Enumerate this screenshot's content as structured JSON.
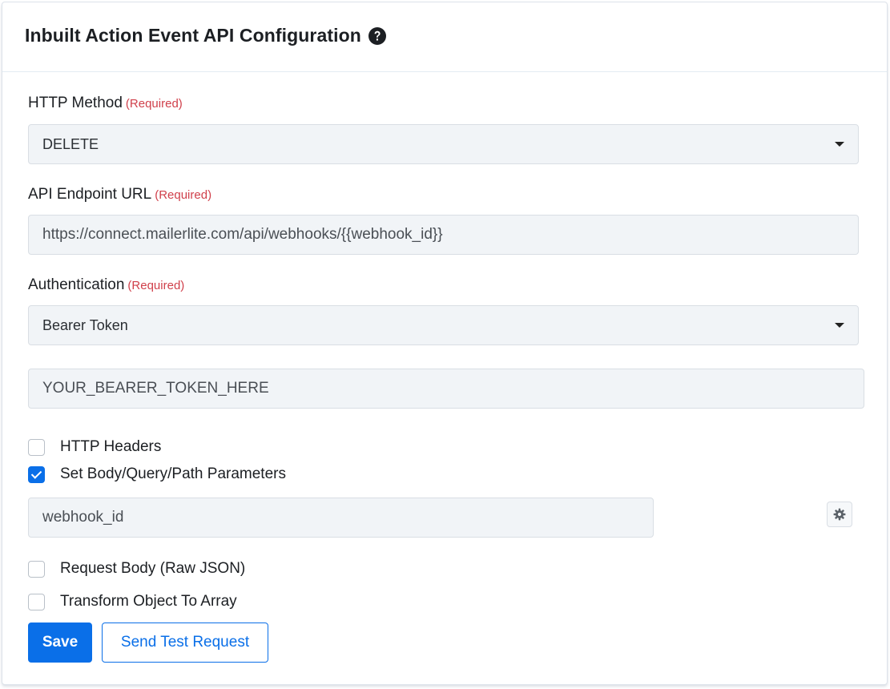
{
  "header": {
    "title": "Inbuilt Action Event API Configuration",
    "help_icon": "question-circle-icon"
  },
  "required_text": "(Required)",
  "http_method": {
    "label": "HTTP Method",
    "required": "(Required)",
    "selected": "DELETE"
  },
  "endpoint": {
    "label": "API Endpoint URL",
    "required": "(Required)",
    "value": "https://connect.mailerlite.com/api/webhooks/{{webhook_id}}"
  },
  "authentication": {
    "label": "Authentication",
    "required": "(Required)",
    "selected": "Bearer Token",
    "token_value": "YOUR_BEARER_TOKEN_HERE"
  },
  "options": {
    "http_headers": {
      "label": "HTTP Headers",
      "checked": false
    },
    "set_params": {
      "label": "Set Body/Query/Path Parameters",
      "checked": true
    },
    "request_body": {
      "label": "Request Body (Raw JSON)",
      "checked": false
    },
    "transform": {
      "label": "Transform Object To Array",
      "checked": false
    }
  },
  "parameter": {
    "value": "webhook_id",
    "settings_icon": "gear-icon"
  },
  "buttons": {
    "save": "Save",
    "send_test": "Send Test Request"
  },
  "colors": {
    "primary": "#0a6fe8",
    "required": "#d0404b",
    "field_bg": "#f1f4f7"
  }
}
